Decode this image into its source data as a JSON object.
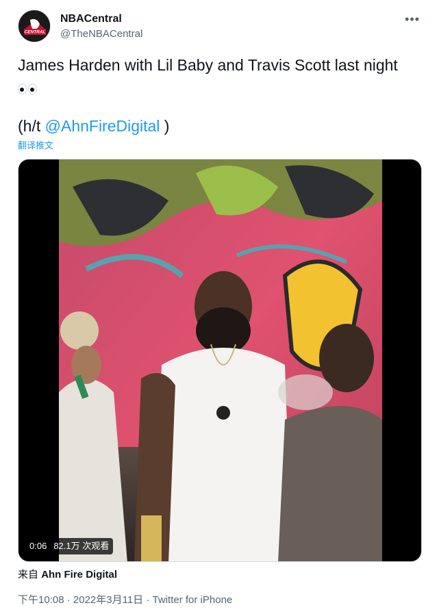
{
  "tweet": {
    "display_name": "NBACentral",
    "handle": "@TheNBACentral",
    "more_icon": "more-horizontal-icon",
    "text_line1": "James Harden with Lil Baby and Travis Scott last night",
    "emoji": "eyes",
    "ht_prefix": "(h/t ",
    "mention": "@AhnFireDigital",
    "ht_suffix": " )",
    "translate_label": "翻译推文"
  },
  "media": {
    "type": "video",
    "timestamp": "0:06",
    "views": "82.1万 次观看"
  },
  "source": {
    "prefix": "来自",
    "name": "Ahn Fire Digital"
  },
  "meta": {
    "time": "下午10:08",
    "sep1": " · ",
    "date": "2022年3月11日",
    "sep2": " · ",
    "app": "Twitter for iPhone"
  },
  "colors": {
    "accent": "#1d9bf0",
    "text": "#0f1419",
    "muted": "#536471"
  }
}
